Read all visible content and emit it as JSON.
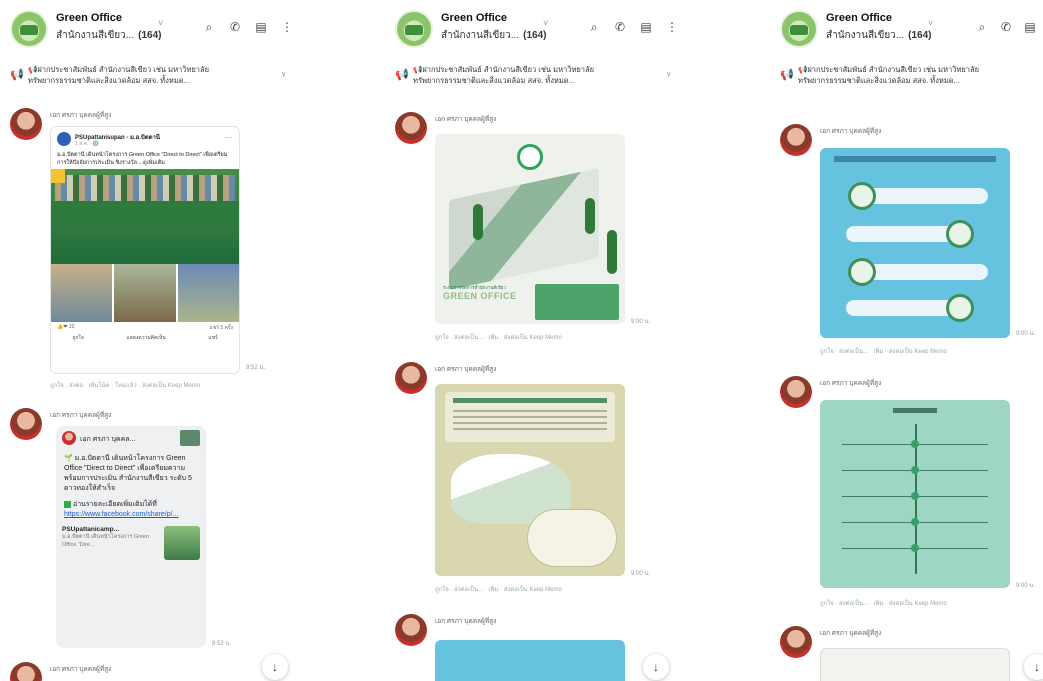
{
  "header": {
    "title": "Green Office",
    "subtitle": "สำนักงานสีเขียว...",
    "member_count": "(164)",
    "icons": [
      "search-icon",
      "phone-icon",
      "panel-icon",
      "more-icon"
    ]
  },
  "announcement": {
    "icon": "megaphone-icon",
    "text": "📢ฝากประชาสัมพันธ์ สำนักงานสีเขียว เช่น มหาวิทยาลัยทรัพยากรธรรมชาติและสิ่งแวดล้อม สสจ. ทั้งหมด..."
  },
  "panels": {
    "p1": {
      "msg1": {
        "sender": "เอก ศรภา บุคคลผู้ที่สูง",
        "fb_page": "PSUpattanisupan - ม.อ.ปัตตานี",
        "fb_time": "1 ส.ค. · 🌐",
        "fb_caption": "ม.อ.ปัตตานี เดินหน้าโครงการ Green Office \"Direct to Direct\" เพื่อเตรียมการให้ปัจจัยการประเมิน ชิงรางวัล ...ดูเพิ่มเติม",
        "fb_reactions": "👍❤ 10",
        "fb_shares": "แชร์ 5 ครั้ง",
        "fb_action_like": "ถูกใจ",
        "fb_action_comment": "แสดงความคิดเห็น",
        "fb_action_share": "แชร์",
        "time": "8:52 น.",
        "reactions": "ถูกใจ · ส่งต่อ · เพิ่มโน้ต · ใหม่แล้ว · ส่งต่อเป็น Keep Memo"
      },
      "msg2": {
        "sender": "เอก ศรภา บุคคลผู้ที่สูง",
        "card_name": "เอก ศรภา บุคคล...",
        "body_line1": "🌱 ม.อ.ปัตตานี เดินหน้าโครงการ Green Office \"Direct to Direct\" เพื่อเตรียมความพร้อมการประเมิน สำนักงานสีเขียว ระดับ 5 ดาวทองให้สำเร็จ",
        "body_line2": "อ่านรายละเอียดเพิ่มเติมได้ที่",
        "link": "https://www.facebook.com/share/p/...",
        "preview_title": "PSUpattanicamp...",
        "preview_sub": "ม.อ.ปัตตานี เดินหน้าโครงการ Green Office \"Dire...",
        "time": "8:52 น."
      },
      "msg3": {
        "sender": "เอก ศรภา บุคคลผู้ที่สูง"
      }
    },
    "p2": {
      "msg1": {
        "sender": "เอก ศรภา บุคคลผู้ที่สูง",
        "info_line1": "ระบบการจัดการสำนักงานสีเขียว",
        "info_line2": "GREEN OFFICE",
        "time": "9:00 น.",
        "reactions": "ถูกใจ · ส่งต่อเป็น... · เพิ่ม · ส่งต่อเป็น Keep Memo"
      },
      "msg2": {
        "sender": "เอก ศรภา บุคคลผู้ที่สูง",
        "time": "9:00 น.",
        "reactions": "ถูกใจ · ส่งต่อเป็น... · เพิ่ม · ส่งต่อเป็น Keep Memo"
      },
      "msg3": {
        "sender": "เอก ศรภา บุคคลผู้ที่สูง"
      }
    },
    "p3": {
      "msg1": {
        "sender": "เอก ศรภา บุคคลผู้ที่สูง",
        "time": "9:00 น.",
        "reactions": "ถูกใจ · ส่งต่อเป็น... · เพิ่ม · ส่งต่อเป็น Keep Memo"
      },
      "msg2": {
        "sender": "เอก ศรภา บุคคลผู้ที่สูง",
        "time": "9:00 น.",
        "reactions": "ถูกใจ · ส่งต่อเป็น... · เพิ่ม · ส่งต่อเป็น Keep Memo"
      },
      "msg3": {
        "sender": "เอก ศรภา บุคคลผู้ที่สูง"
      }
    }
  },
  "glyphs": {
    "chev": "˅",
    "search": "⌕",
    "phone": "✆",
    "panel": "▤",
    "more": "⋮",
    "mega": "📢",
    "down": "↓",
    "dots": "···"
  },
  "colors": {
    "accent": "#2b6ed4",
    "green": "#2fa35a",
    "link": "#1a5fd0"
  }
}
